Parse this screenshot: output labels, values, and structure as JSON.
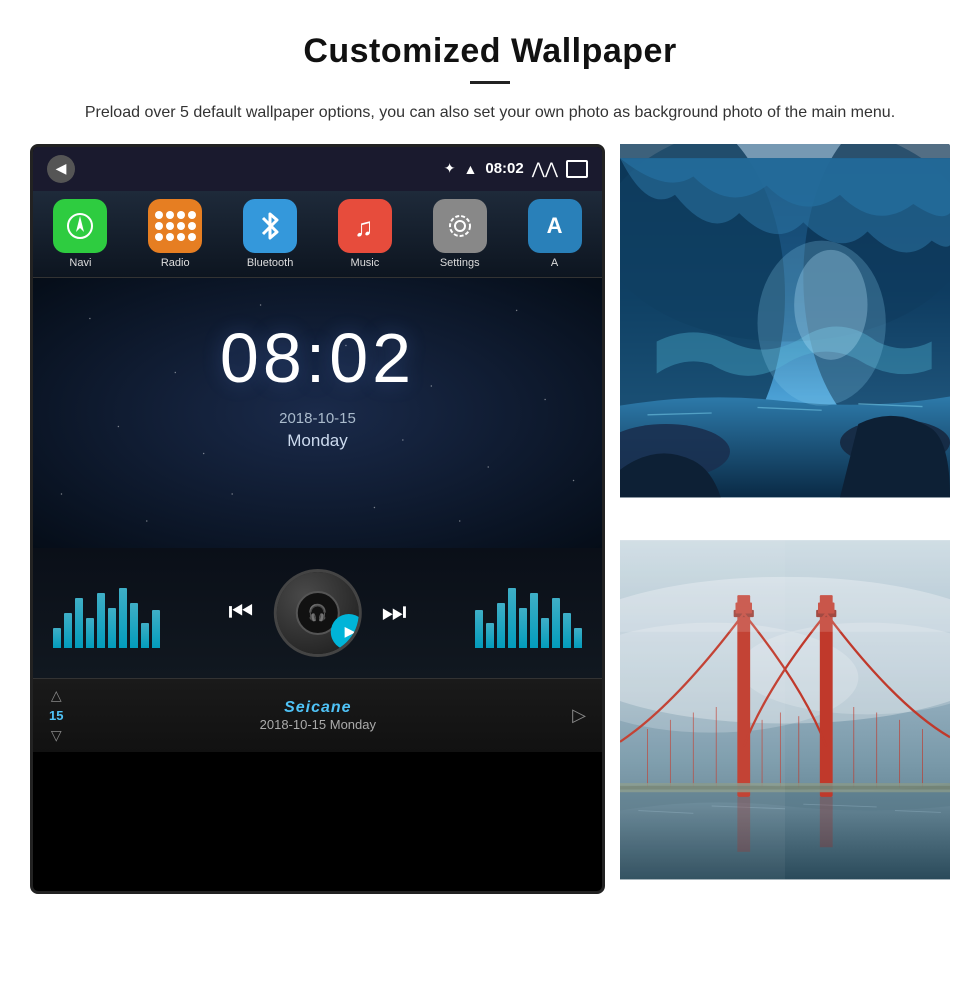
{
  "header": {
    "title": "Customized Wallpaper",
    "description": "Preload over 5 default wallpaper options, you can also set your own photo as background photo of the main menu."
  },
  "device": {
    "status_bar": {
      "time": "08:02",
      "bluetooth_icon": "✦",
      "signal_icon": "▲",
      "double_arrow": "⋀⋀"
    },
    "app_icons": [
      {
        "label": "Navi",
        "color": "#2ecc40"
      },
      {
        "label": "Radio",
        "color": "#e67e22"
      },
      {
        "label": "Bluetooth",
        "color": "#3498db"
      },
      {
        "label": "Music",
        "color": "#e74c3c"
      },
      {
        "label": "Settings",
        "color": "#888888"
      },
      {
        "label": "A",
        "color": "#2980b9"
      }
    ],
    "clock": {
      "time": "08:02",
      "date": "2018-10-15",
      "day": "Monday"
    },
    "music": {
      "prev_label": "⏮",
      "play_label": "▶",
      "next_label": "⏭"
    },
    "bottom_bar": {
      "number": "15",
      "brand": "Seicane",
      "date": "2018-10-15  Monday"
    }
  },
  "wallpapers": {
    "image1_alt": "Ice cave with blue water",
    "image2_alt": "Golden Gate Bridge in fog"
  }
}
